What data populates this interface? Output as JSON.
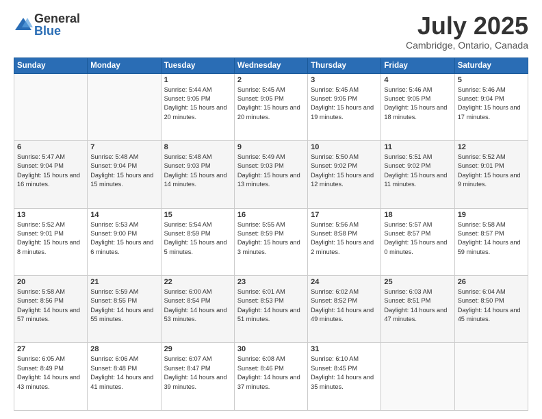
{
  "logo": {
    "general": "General",
    "blue": "Blue"
  },
  "title": "July 2025",
  "location": "Cambridge, Ontario, Canada",
  "days_header": [
    "Sunday",
    "Monday",
    "Tuesday",
    "Wednesday",
    "Thursday",
    "Friday",
    "Saturday"
  ],
  "weeks": [
    [
      {
        "num": "",
        "sunrise": "",
        "sunset": "",
        "daylight": ""
      },
      {
        "num": "",
        "sunrise": "",
        "sunset": "",
        "daylight": ""
      },
      {
        "num": "1",
        "sunrise": "Sunrise: 5:44 AM",
        "sunset": "Sunset: 9:05 PM",
        "daylight": "Daylight: 15 hours and 20 minutes."
      },
      {
        "num": "2",
        "sunrise": "Sunrise: 5:45 AM",
        "sunset": "Sunset: 9:05 PM",
        "daylight": "Daylight: 15 hours and 20 minutes."
      },
      {
        "num": "3",
        "sunrise": "Sunrise: 5:45 AM",
        "sunset": "Sunset: 9:05 PM",
        "daylight": "Daylight: 15 hours and 19 minutes."
      },
      {
        "num": "4",
        "sunrise": "Sunrise: 5:46 AM",
        "sunset": "Sunset: 9:05 PM",
        "daylight": "Daylight: 15 hours and 18 minutes."
      },
      {
        "num": "5",
        "sunrise": "Sunrise: 5:46 AM",
        "sunset": "Sunset: 9:04 PM",
        "daylight": "Daylight: 15 hours and 17 minutes."
      }
    ],
    [
      {
        "num": "6",
        "sunrise": "Sunrise: 5:47 AM",
        "sunset": "Sunset: 9:04 PM",
        "daylight": "Daylight: 15 hours and 16 minutes."
      },
      {
        "num": "7",
        "sunrise": "Sunrise: 5:48 AM",
        "sunset": "Sunset: 9:04 PM",
        "daylight": "Daylight: 15 hours and 15 minutes."
      },
      {
        "num": "8",
        "sunrise": "Sunrise: 5:48 AM",
        "sunset": "Sunset: 9:03 PM",
        "daylight": "Daylight: 15 hours and 14 minutes."
      },
      {
        "num": "9",
        "sunrise": "Sunrise: 5:49 AM",
        "sunset": "Sunset: 9:03 PM",
        "daylight": "Daylight: 15 hours and 13 minutes."
      },
      {
        "num": "10",
        "sunrise": "Sunrise: 5:50 AM",
        "sunset": "Sunset: 9:02 PM",
        "daylight": "Daylight: 15 hours and 12 minutes."
      },
      {
        "num": "11",
        "sunrise": "Sunrise: 5:51 AM",
        "sunset": "Sunset: 9:02 PM",
        "daylight": "Daylight: 15 hours and 11 minutes."
      },
      {
        "num": "12",
        "sunrise": "Sunrise: 5:52 AM",
        "sunset": "Sunset: 9:01 PM",
        "daylight": "Daylight: 15 hours and 9 minutes."
      }
    ],
    [
      {
        "num": "13",
        "sunrise": "Sunrise: 5:52 AM",
        "sunset": "Sunset: 9:01 PM",
        "daylight": "Daylight: 15 hours and 8 minutes."
      },
      {
        "num": "14",
        "sunrise": "Sunrise: 5:53 AM",
        "sunset": "Sunset: 9:00 PM",
        "daylight": "Daylight: 15 hours and 6 minutes."
      },
      {
        "num": "15",
        "sunrise": "Sunrise: 5:54 AM",
        "sunset": "Sunset: 8:59 PM",
        "daylight": "Daylight: 15 hours and 5 minutes."
      },
      {
        "num": "16",
        "sunrise": "Sunrise: 5:55 AM",
        "sunset": "Sunset: 8:59 PM",
        "daylight": "Daylight: 15 hours and 3 minutes."
      },
      {
        "num": "17",
        "sunrise": "Sunrise: 5:56 AM",
        "sunset": "Sunset: 8:58 PM",
        "daylight": "Daylight: 15 hours and 2 minutes."
      },
      {
        "num": "18",
        "sunrise": "Sunrise: 5:57 AM",
        "sunset": "Sunset: 8:57 PM",
        "daylight": "Daylight: 15 hours and 0 minutes."
      },
      {
        "num": "19",
        "sunrise": "Sunrise: 5:58 AM",
        "sunset": "Sunset: 8:57 PM",
        "daylight": "Daylight: 14 hours and 59 minutes."
      }
    ],
    [
      {
        "num": "20",
        "sunrise": "Sunrise: 5:58 AM",
        "sunset": "Sunset: 8:56 PM",
        "daylight": "Daylight: 14 hours and 57 minutes."
      },
      {
        "num": "21",
        "sunrise": "Sunrise: 5:59 AM",
        "sunset": "Sunset: 8:55 PM",
        "daylight": "Daylight: 14 hours and 55 minutes."
      },
      {
        "num": "22",
        "sunrise": "Sunrise: 6:00 AM",
        "sunset": "Sunset: 8:54 PM",
        "daylight": "Daylight: 14 hours and 53 minutes."
      },
      {
        "num": "23",
        "sunrise": "Sunrise: 6:01 AM",
        "sunset": "Sunset: 8:53 PM",
        "daylight": "Daylight: 14 hours and 51 minutes."
      },
      {
        "num": "24",
        "sunrise": "Sunrise: 6:02 AM",
        "sunset": "Sunset: 8:52 PM",
        "daylight": "Daylight: 14 hours and 49 minutes."
      },
      {
        "num": "25",
        "sunrise": "Sunrise: 6:03 AM",
        "sunset": "Sunset: 8:51 PM",
        "daylight": "Daylight: 14 hours and 47 minutes."
      },
      {
        "num": "26",
        "sunrise": "Sunrise: 6:04 AM",
        "sunset": "Sunset: 8:50 PM",
        "daylight": "Daylight: 14 hours and 45 minutes."
      }
    ],
    [
      {
        "num": "27",
        "sunrise": "Sunrise: 6:05 AM",
        "sunset": "Sunset: 8:49 PM",
        "daylight": "Daylight: 14 hours and 43 minutes."
      },
      {
        "num": "28",
        "sunrise": "Sunrise: 6:06 AM",
        "sunset": "Sunset: 8:48 PM",
        "daylight": "Daylight: 14 hours and 41 minutes."
      },
      {
        "num": "29",
        "sunrise": "Sunrise: 6:07 AM",
        "sunset": "Sunset: 8:47 PM",
        "daylight": "Daylight: 14 hours and 39 minutes."
      },
      {
        "num": "30",
        "sunrise": "Sunrise: 6:08 AM",
        "sunset": "Sunset: 8:46 PM",
        "daylight": "Daylight: 14 hours and 37 minutes."
      },
      {
        "num": "31",
        "sunrise": "Sunrise: 6:10 AM",
        "sunset": "Sunset: 8:45 PM",
        "daylight": "Daylight: 14 hours and 35 minutes."
      },
      {
        "num": "",
        "sunrise": "",
        "sunset": "",
        "daylight": ""
      },
      {
        "num": "",
        "sunrise": "",
        "sunset": "",
        "daylight": ""
      }
    ]
  ]
}
